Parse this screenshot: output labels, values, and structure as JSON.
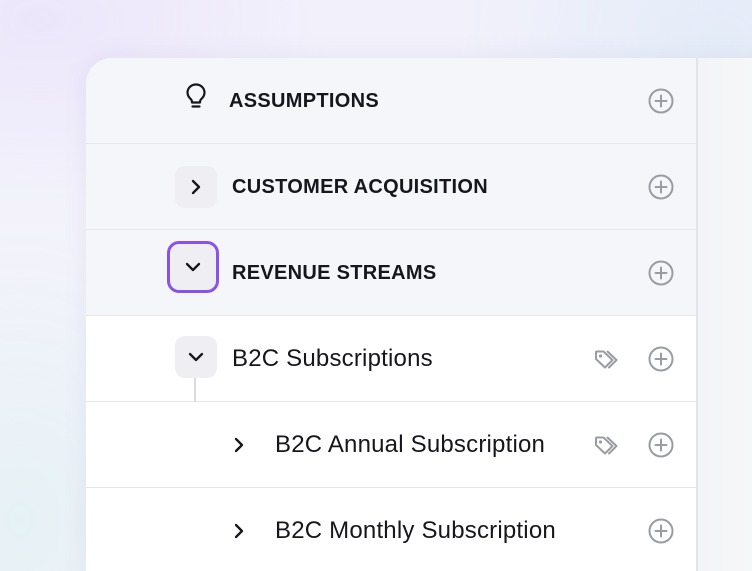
{
  "rows": [
    {
      "label": "ASSUMPTIONS",
      "icon": "lightbulb-icon"
    },
    {
      "label": "CUSTOMER ACQUISITION",
      "icon": "chevron-right-icon"
    },
    {
      "label": "REVENUE STREAMS",
      "icon": "chevron-down-icon"
    },
    {
      "label": "B2C Subscriptions",
      "icon": "chevron-down-icon"
    },
    {
      "label": "B2C Annual Subscription",
      "icon": "chevron-right-icon"
    },
    {
      "label": "B2C Monthly Subscription",
      "icon": "chevron-right-icon"
    }
  ],
  "icons": {
    "add": "plus-circle-icon",
    "tag": "tags-icon"
  },
  "colors": {
    "focus_ring": "#8a52ea",
    "text": "#16161d",
    "icon_gray": "#9a9ca4",
    "section_bg": "#f5f6f9"
  }
}
